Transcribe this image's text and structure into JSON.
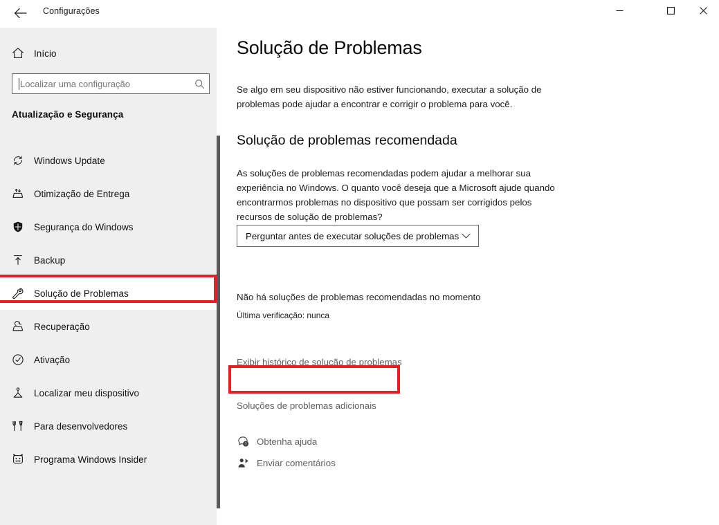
{
  "window": {
    "title": "Configurações",
    "back_icon": "back-arrow-icon",
    "controls": {
      "minimize": "minimize-icon",
      "maximize": "maximize-icon",
      "close": "close-icon"
    }
  },
  "sidebar": {
    "home": {
      "label": "Início",
      "icon": "home-icon"
    },
    "search": {
      "placeholder": "Localizar uma configuração",
      "value": "",
      "icon": "search-icon"
    },
    "group_heading": "Atualização e Segurança",
    "items": [
      {
        "label": "Windows Update",
        "icon": "update-refresh-icon",
        "selected": false
      },
      {
        "label": "Otimização de Entrega",
        "icon": "delivery-optimization-icon",
        "selected": false
      },
      {
        "label": "Segurança do Windows",
        "icon": "shield-icon",
        "selected": false
      },
      {
        "label": "Backup",
        "icon": "backup-upload-icon",
        "selected": false
      },
      {
        "label": "Solução de Problemas",
        "icon": "wrench-icon",
        "selected": true
      },
      {
        "label": "Recuperação",
        "icon": "recovery-icon",
        "selected": false
      },
      {
        "label": "Ativação",
        "icon": "check-circle-icon",
        "selected": false
      },
      {
        "label": "Localizar meu dispositivo",
        "icon": "locate-device-icon",
        "selected": false
      },
      {
        "label": "Para desenvolvedores",
        "icon": "developer-tools-icon",
        "selected": false
      },
      {
        "label": "Programa Windows Insider",
        "icon": "insider-cat-icon",
        "selected": false
      }
    ]
  },
  "main": {
    "page_title": "Solução de Problemas",
    "page_description": "Se algo em seu dispositivo não estiver funcionando, executar a solução de problemas pode ajudar a encontrar e corrigir o problema para você.",
    "section_title": "Solução de problemas recomendada",
    "section_description": "As soluções de problemas recomendadas podem ajudar a melhorar sua experiência no Windows. O quanto você deseja que a Microsoft ajude quando encontrarmos problemas no dispositivo que possam ser corrigidos pelos recursos de solução de problemas?",
    "dropdown": {
      "value": "Perguntar antes de executar soluções de problemas",
      "icon": "chevron-down-icon"
    },
    "status_main": "Não há soluções de problemas recomendadas no momento",
    "status_sub": "Última verificação: nunca",
    "link_history": "Exibir histórico de solução de problemas",
    "link_additional": "Soluções de problemas adicionais",
    "help": [
      {
        "label": "Obtenha ajuda",
        "icon": "help-question-bubble-icon"
      },
      {
        "label": "Enviar comentários",
        "icon": "send-feedback-icon"
      }
    ]
  },
  "annotations": {
    "highlight_color": "#ed1c24",
    "boxes": [
      {
        "target": "Solução de Problemas"
      },
      {
        "target": "Soluções de problemas adicionais"
      }
    ]
  }
}
